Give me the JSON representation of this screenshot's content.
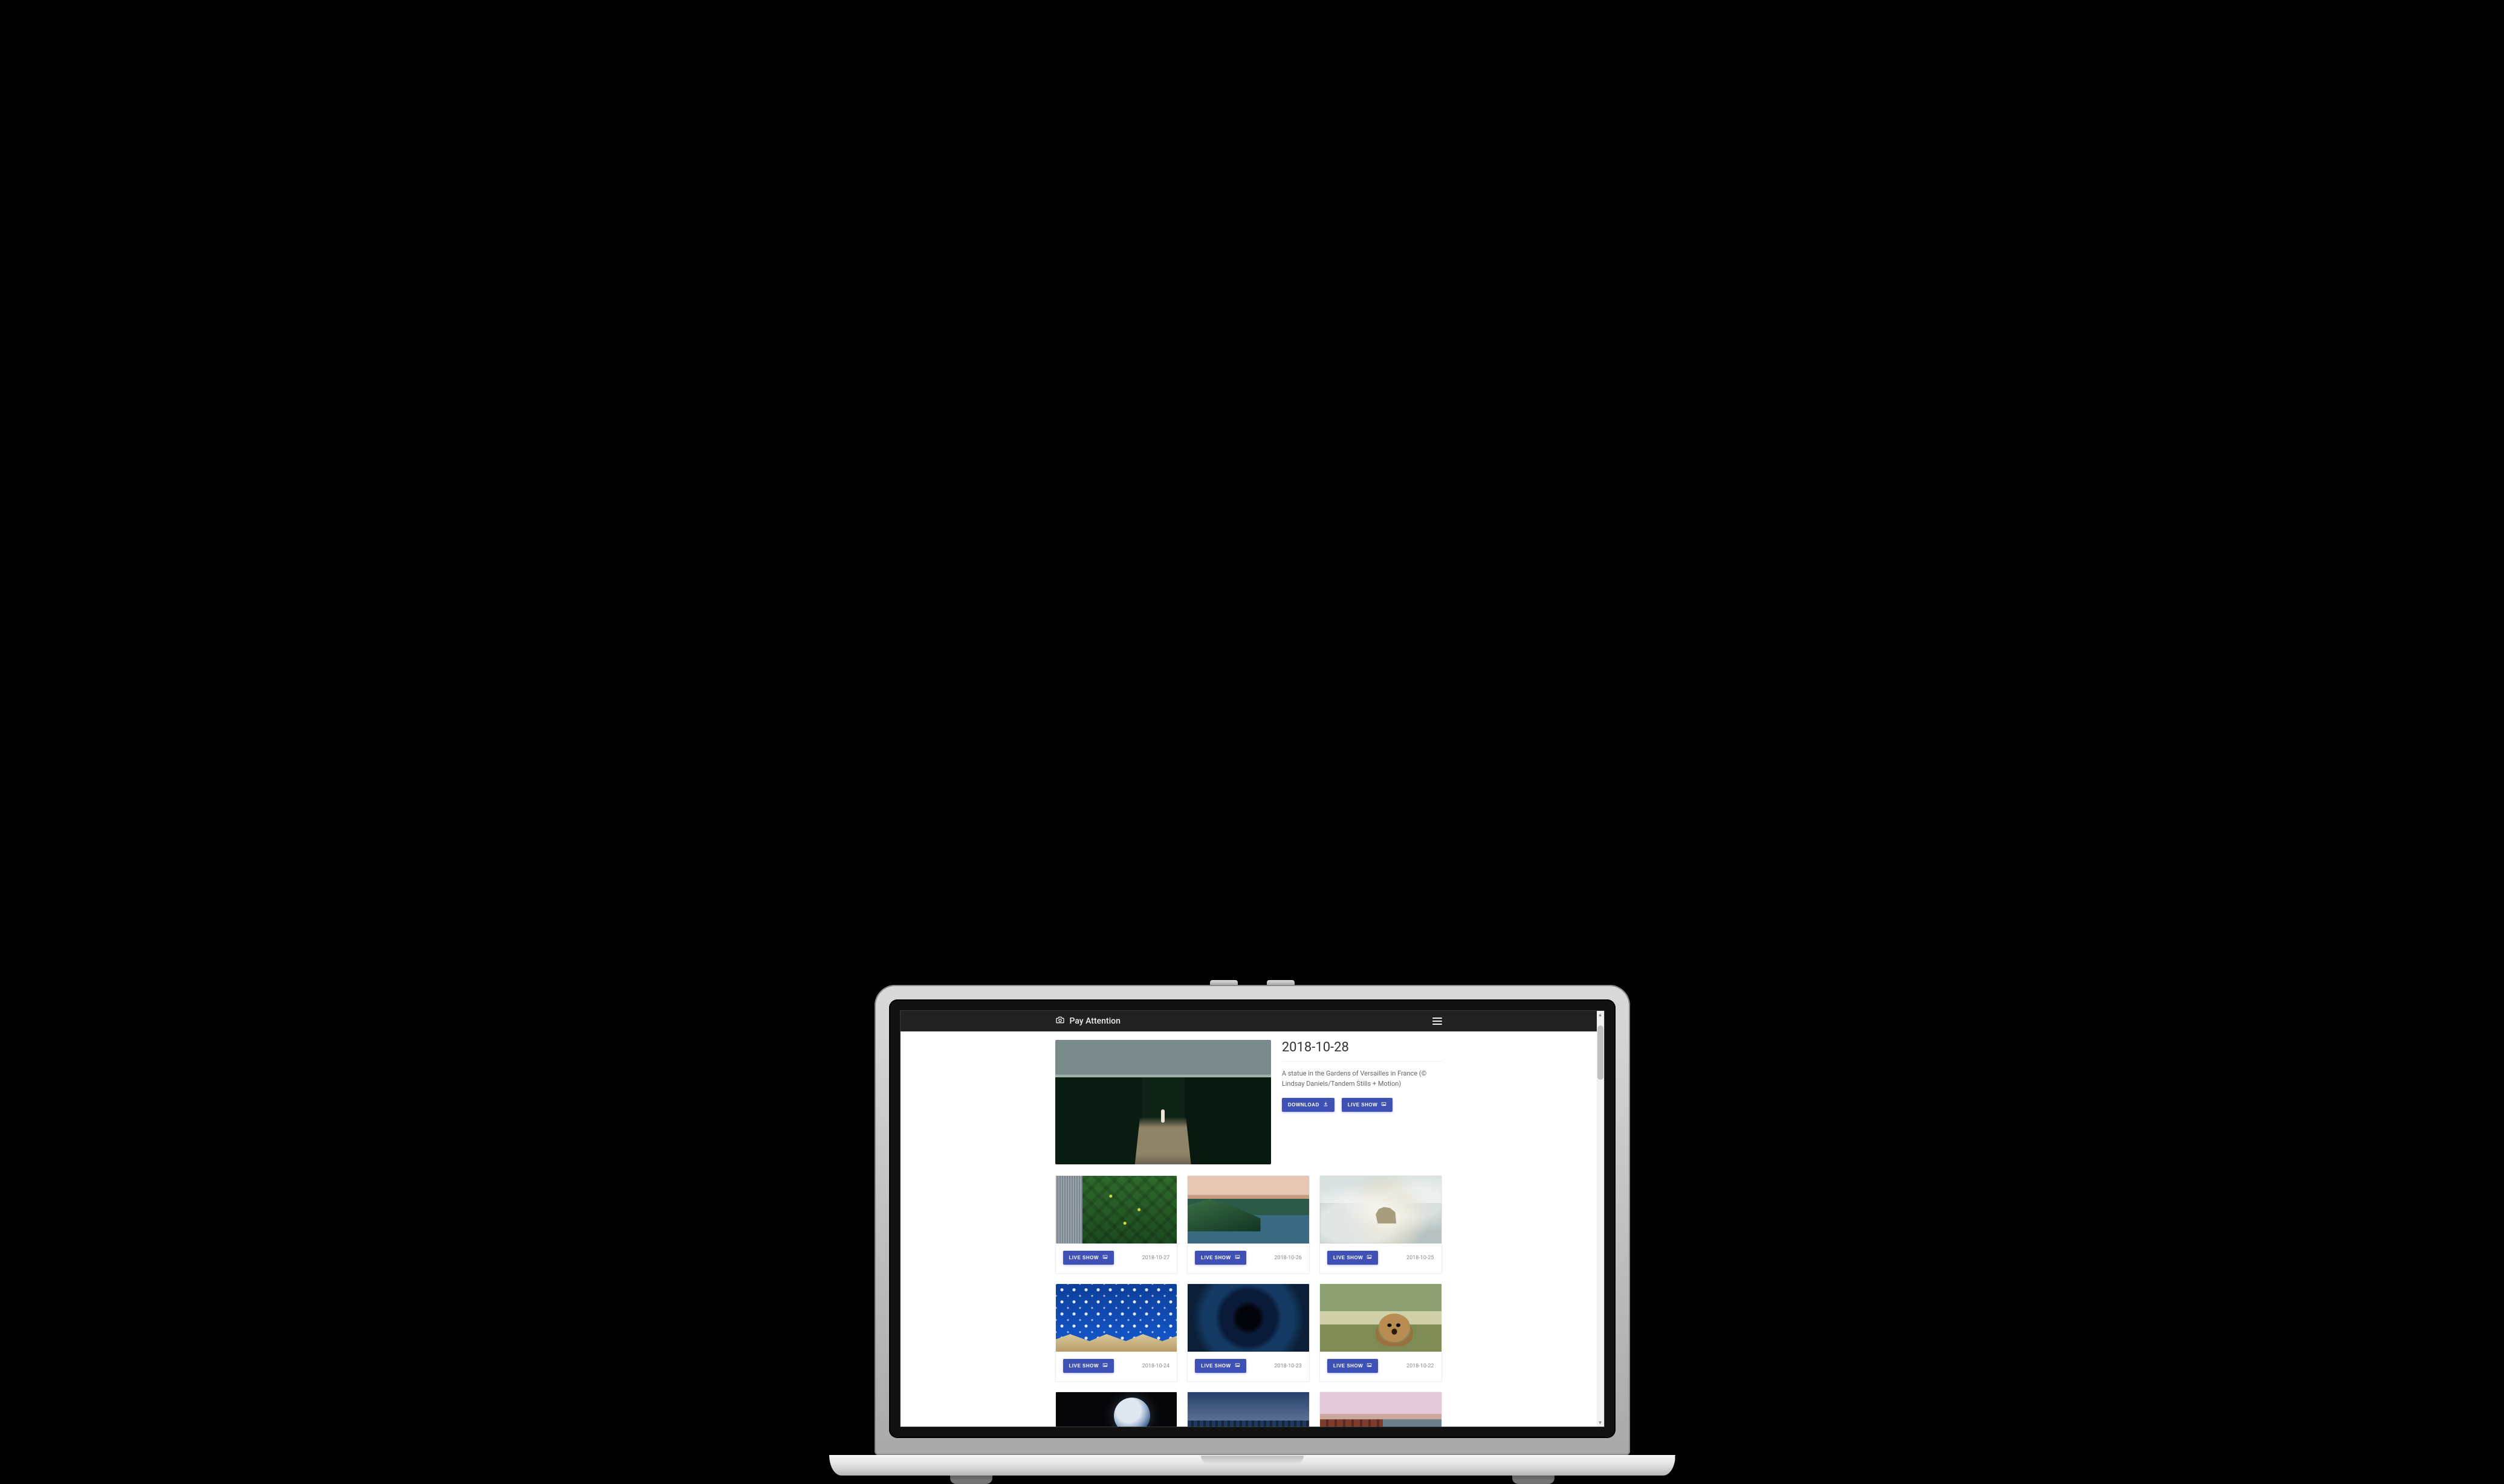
{
  "brand": {
    "title": "Pay Attention"
  },
  "hero": {
    "date": "2018-10-28",
    "caption": "A statue in the Gardens of Versailles in France (© Lindsay Daniels/Tandem Stills + Motion)",
    "download_label": "DOWNLOAD",
    "liveshow_label": "LIVE SHOW"
  },
  "card_button_label": "LIVE SHOW",
  "cards": [
    {
      "date": "2018-10-27"
    },
    {
      "date": "2018-10-26"
    },
    {
      "date": "2018-10-25"
    },
    {
      "date": "2018-10-24"
    },
    {
      "date": "2018-10-23"
    },
    {
      "date": "2018-10-22"
    }
  ]
}
